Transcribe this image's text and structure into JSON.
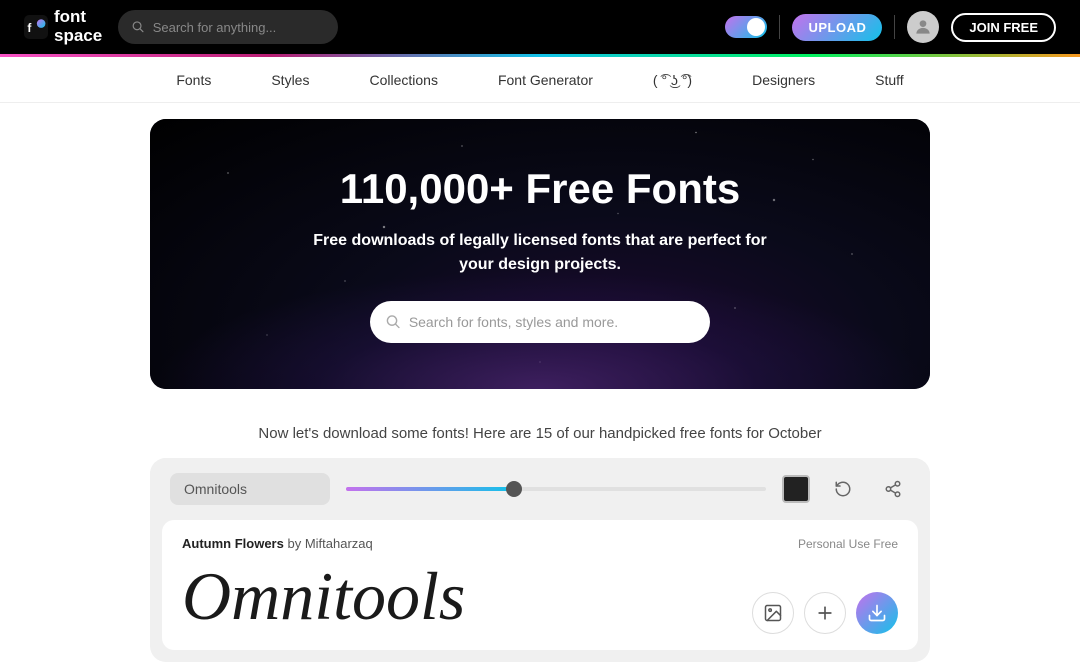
{
  "header": {
    "logo_line1": "font",
    "logo_line2": "space",
    "search_placeholder": "Search for anything...",
    "upload_label": "UPLOAD",
    "join_label": "JOIN FREE"
  },
  "nav": {
    "items": [
      {
        "label": "Fonts"
      },
      {
        "label": "Styles"
      },
      {
        "label": "Collections"
      },
      {
        "label": "Font Generator"
      },
      {
        "label": "( ͡° ͜ʖ ͡°)"
      },
      {
        "label": "Designers"
      },
      {
        "label": "Stuff"
      }
    ]
  },
  "hero": {
    "title": "110,000+ Free Fonts",
    "subtitle": "Free downloads of legally licensed fonts that are perfect for your design projects.",
    "search_placeholder": "Search for fonts, styles and more."
  },
  "section": {
    "subtitle": "Now let's download some fonts! Here are 15 of our handpicked free fonts for October"
  },
  "font_card": {
    "preview_text_input": "Omnitools",
    "font_name": "Autumn Flowers",
    "designer": "Miftaharzaq",
    "license": "Personal Use Free",
    "preview_text": "Omnitools"
  }
}
